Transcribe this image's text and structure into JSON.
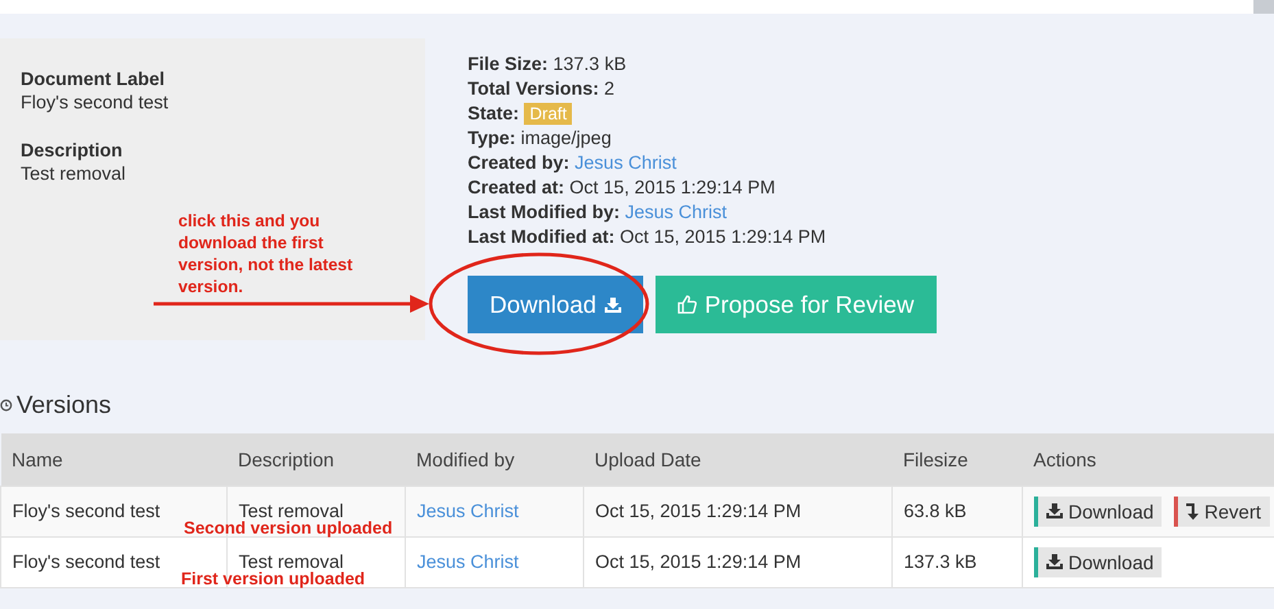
{
  "document": {
    "label_heading": "Document Label",
    "label": "Floy's second test",
    "description_heading": "Description",
    "description": "Test removal"
  },
  "meta": [
    {
      "label": "File Size:",
      "value": "137.3 kB",
      "kind": "text"
    },
    {
      "label": "Total Versions:",
      "value": "2",
      "kind": "text"
    },
    {
      "label": "State:",
      "value": "Draft",
      "kind": "badge"
    },
    {
      "label": "Type:",
      "value": "image/jpeg",
      "kind": "text"
    },
    {
      "label": "Created by:",
      "value": "Jesus Christ",
      "kind": "link"
    },
    {
      "label": "Created at:",
      "value": "Oct 15, 2015 1:29:14 PM",
      "kind": "text"
    },
    {
      "label": "Last Modified by:",
      "value": "Jesus Christ",
      "kind": "link"
    },
    {
      "label": "Last Modified at:",
      "value": "Oct 15, 2015 1:29:14 PM",
      "kind": "text"
    }
  ],
  "buttons": [
    {
      "label": "Download",
      "kind": "download"
    },
    {
      "label": "Propose for Review",
      "kind": "propose"
    }
  ],
  "callout": "click this and you download the first version, not the latest version.",
  "versions": {
    "title": "Versions",
    "columns": [
      "Name",
      "Description",
      "Modified by",
      "Upload Date",
      "Filesize",
      "Actions"
    ],
    "rows": [
      {
        "name": "Floy's second test",
        "description": "Test removal",
        "modified_by": "Jesus Christ",
        "upload_date": "Oct 15, 2015 1:29:14 PM",
        "filesize": "63.8 kB",
        "note": "Second version uploaded",
        "actions": [
          {
            "label": "Download",
            "kind": "download"
          },
          {
            "label": "Revert",
            "kind": "revert"
          }
        ]
      },
      {
        "name": "Floy's second test",
        "description": "Test removal",
        "modified_by": "Jesus Christ",
        "upload_date": "Oct 15, 2015 1:29:14 PM",
        "filesize": "137.3 kB",
        "note": "First version uploaded",
        "actions": [
          {
            "label": "Download",
            "kind": "download"
          }
        ]
      }
    ]
  }
}
